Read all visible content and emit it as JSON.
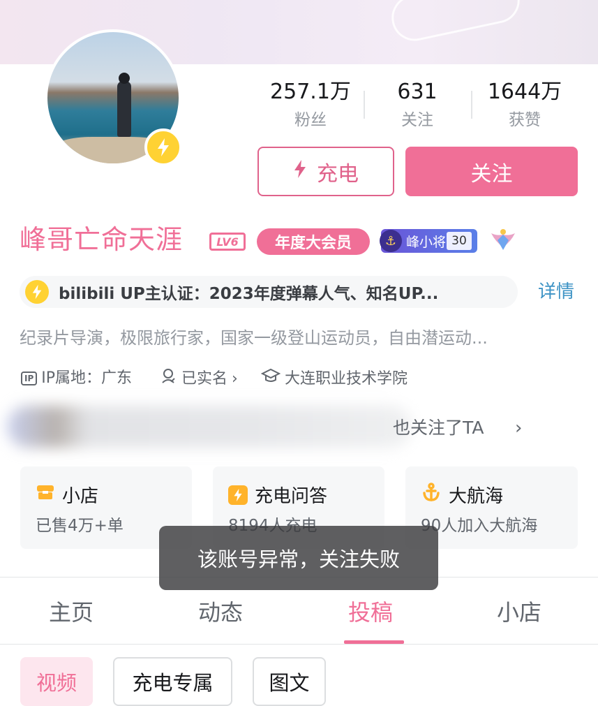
{
  "profile": {
    "name": "峰哥亡命天涯",
    "level": "LV6",
    "vip": "年度大会员",
    "guard_name": "峰小将",
    "guard_level": "30",
    "stats": [
      {
        "value": "257.1万",
        "label": "粉丝"
      },
      {
        "value": "631",
        "label": "关注"
      },
      {
        "value": "1644万",
        "label": "获赞"
      }
    ],
    "charge_label": "充电",
    "follow_label": "关注",
    "cert": "bilibili UP主认证：2023年度弹幕人气、知名UP...",
    "cert_more": "详情",
    "desc": "纪录片导演，极限旅行家，国家一级登山运动员，自由潜运动...",
    "ip": "IP属地：广东",
    "ip_tag": "IP",
    "verified": "已实名",
    "school": "大连职业技术学院",
    "mutual_follow": "也关注了TA"
  },
  "cards": [
    {
      "title": "小店",
      "sub": "已售4万+单"
    },
    {
      "title": "充电问答",
      "sub": "8194人充电"
    },
    {
      "title": "大航海",
      "sub": "90人加入大航海"
    }
  ],
  "toast": "该账号异常，关注失败",
  "tabs": [
    "主页",
    "动态",
    "投稿",
    "小店"
  ],
  "filters": [
    "视频",
    "充电专属",
    "图文"
  ],
  "colors": {
    "accent": "#f06f97",
    "charge": "#ffd233",
    "link": "#3d93c5"
  }
}
